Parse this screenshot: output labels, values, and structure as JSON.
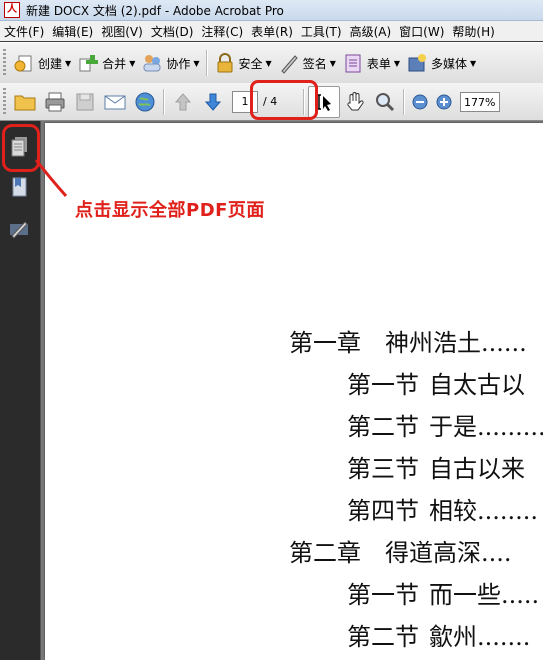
{
  "window": {
    "title": "新建 DOCX 文档 (2).pdf - Adobe Acrobat Pro",
    "app_icon": "acrobat-icon"
  },
  "menu": [
    "文件(F)",
    "编辑(E)",
    "视图(V)",
    "文档(D)",
    "注释(C)",
    "表单(R)",
    "工具(T)",
    "高级(A)",
    "窗口(W)",
    "帮助(H)"
  ],
  "toolbar1": {
    "create": "创建",
    "combine": "合并",
    "collaborate": "协作",
    "secure": "安全",
    "sign": "签名",
    "forms": "表单",
    "multimedia": "多媒体"
  },
  "navigation": {
    "current_page": "1",
    "total_pages": "/ 4",
    "zoom": "177%"
  },
  "annotation": {
    "text": "点击显示全部PDF页面",
    "color": "#e0201b"
  },
  "toc": [
    {
      "num": "第一章",
      "title": "神州浩土......"
    },
    {
      "num": "第一节",
      "title": "自太古以"
    },
    {
      "num": "第二节",
      "title": "于是........."
    },
    {
      "num": "第三节",
      "title": "自古以来"
    },
    {
      "num": "第四节",
      "title": "相较........"
    },
    {
      "num": "第二章",
      "title": "得道高深...."
    },
    {
      "num": "第一节",
      "title": "而一些....."
    },
    {
      "num": "第二节",
      "title": "歙州......."
    }
  ]
}
